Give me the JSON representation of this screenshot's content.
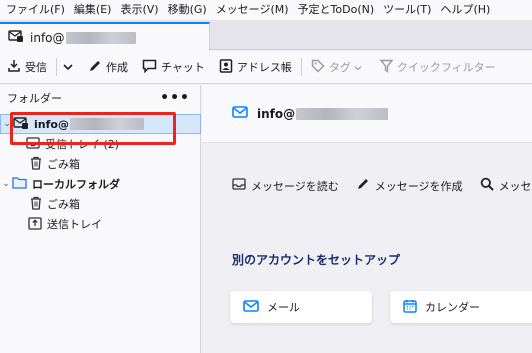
{
  "menubar": {
    "items": [
      "ファイル(F)",
      "編集(E)",
      "表示(V)",
      "移動(G)",
      "メッセージ(M)",
      "予定とToDo(N)",
      "ツール(T)",
      "ヘルプ(H)"
    ]
  },
  "tabs": [
    {
      "label": "info@"
    }
  ],
  "toolbar": {
    "receive": "受信",
    "compose": "作成",
    "chat": "チャット",
    "addressbook": "アドレス帳",
    "tag": "タグ",
    "quickfilter": "クイックフィルター"
  },
  "folderpane": {
    "title": "フォルダー",
    "more": "•••",
    "account": "info@",
    "inbox": "受信トレイ (2)",
    "trash": "ごみ箱",
    "local": "ローカルフォルダ",
    "local_trash": "ごみ箱",
    "outbox": "送信トレイ"
  },
  "main": {
    "account_title": "info@",
    "actions": [
      "メッセージを読む",
      "メッセージを作成",
      "メッセ"
    ],
    "setup_title": "別のアカウントをセットアップ",
    "cards": [
      "メール",
      "カレンダー"
    ]
  },
  "colors": {
    "accent": "#0a84ff",
    "highlight": "#e8251e",
    "selected": "#d6e6fb",
    "heading": "#1b2a6b"
  }
}
